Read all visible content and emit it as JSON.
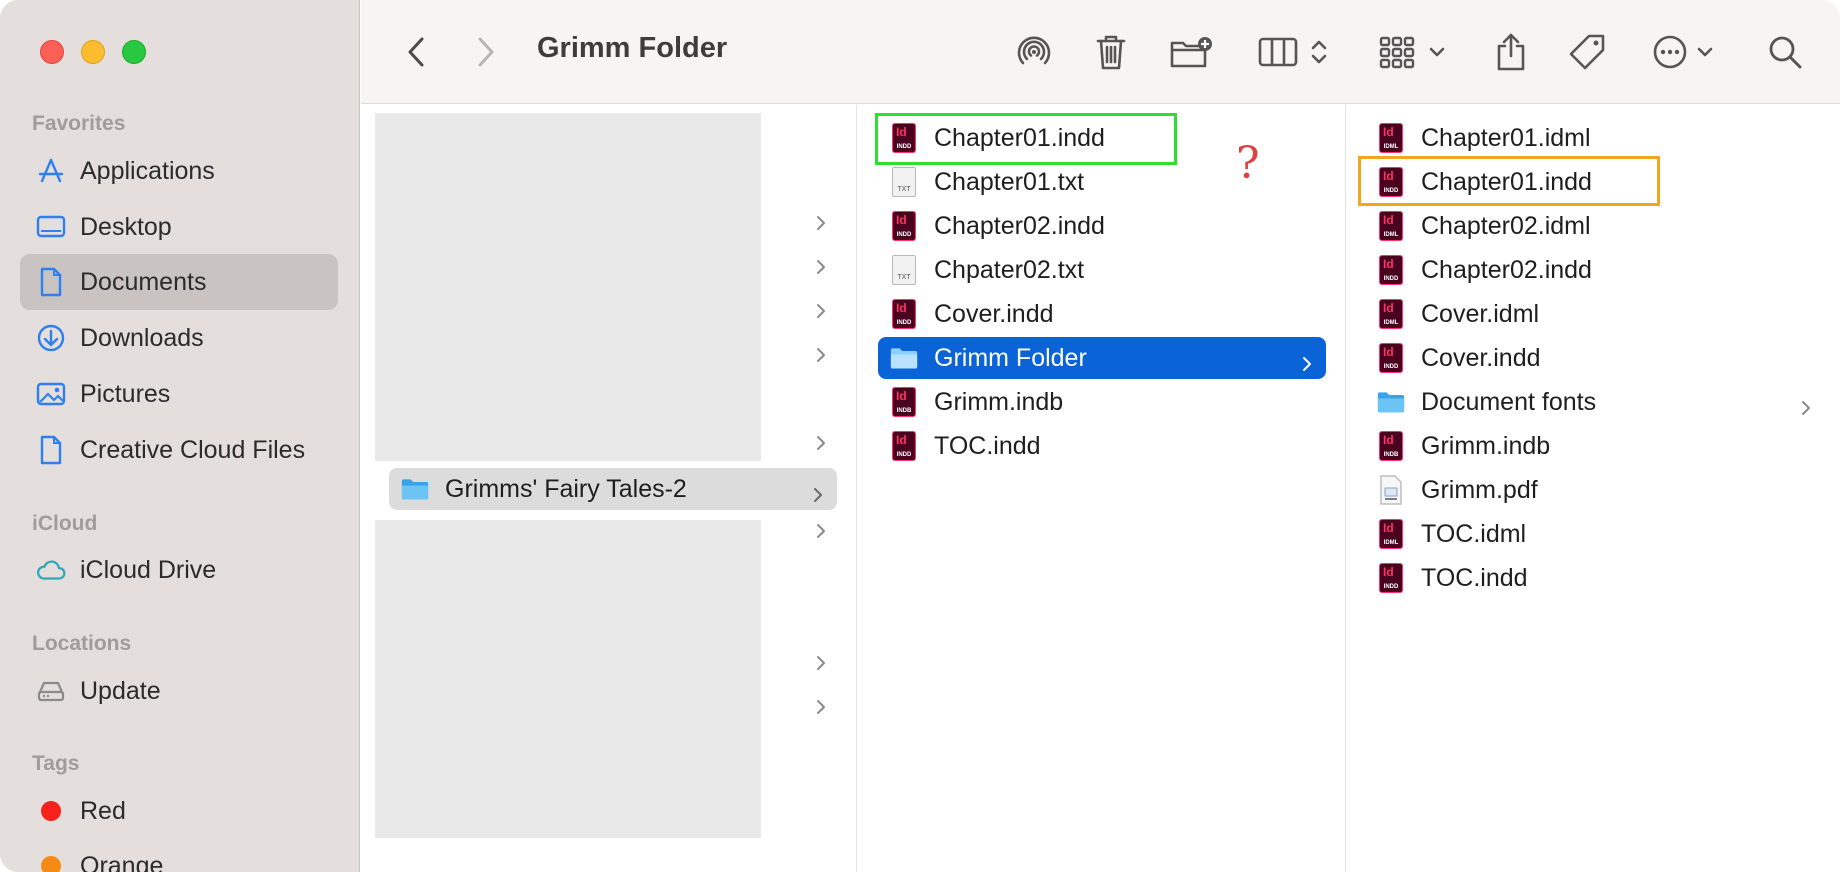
{
  "window": {
    "title": "Grimm Folder"
  },
  "sidebar": {
    "sections": {
      "favorites": "Favorites",
      "icloud": "iCloud",
      "locations": "Locations",
      "tags": "Tags"
    },
    "favorites": [
      "Applications",
      "Desktop",
      "Documents",
      "Downloads",
      "Pictures",
      "Creative Cloud Files"
    ],
    "icloud": [
      "iCloud Drive"
    ],
    "locations": [
      "Update"
    ],
    "tags": [
      {
        "label": "Red",
        "color": "#f5211a"
      },
      {
        "label": "Orange",
        "color": "#f58a14"
      }
    ],
    "active": "Documents"
  },
  "toolbar": {
    "icons": [
      "back-icon",
      "forward-icon",
      "airdrop-icon",
      "trash-icon",
      "new-folder-icon",
      "view-columns-icon",
      "group-icon",
      "share-icon",
      "tag-icon",
      "more-icon",
      "search-icon"
    ]
  },
  "columns": {
    "col1": {
      "selected_folder": "Grimms' Fairy Tales-2"
    },
    "col2": {
      "items": [
        {
          "name": "Chapter01.indd",
          "kind": "indd",
          "ext": "INDD"
        },
        {
          "name": "Chapter01.txt",
          "kind": "txt",
          "ext": "TXT"
        },
        {
          "name": "Chapter02.indd",
          "kind": "indd",
          "ext": "INDD"
        },
        {
          "name": "Chpater02.txt",
          "kind": "txt",
          "ext": "TXT"
        },
        {
          "name": "Cover.indd",
          "kind": "indd",
          "ext": "INDD"
        },
        {
          "name": "Grimm Folder",
          "kind": "folder"
        },
        {
          "name": "Grimm.indb",
          "kind": "indd",
          "ext": "INDB"
        },
        {
          "name": "TOC.indd",
          "kind": "indd",
          "ext": "INDD"
        }
      ],
      "selected": "Grimm Folder"
    },
    "col3": {
      "items": [
        {
          "name": "Chapter01.idml",
          "kind": "indd",
          "ext": "IDML"
        },
        {
          "name": "Chapter01.indd",
          "kind": "indd",
          "ext": "INDD"
        },
        {
          "name": "Chapter02.idml",
          "kind": "indd",
          "ext": "IDML"
        },
        {
          "name": "Chapter02.indd",
          "kind": "indd",
          "ext": "INDD"
        },
        {
          "name": "Cover.idml",
          "kind": "indd",
          "ext": "IDML"
        },
        {
          "name": "Cover.indd",
          "kind": "indd",
          "ext": "INDD"
        },
        {
          "name": "Document fonts",
          "kind": "folder"
        },
        {
          "name": "Grimm.indb",
          "kind": "indd",
          "ext": "INDB"
        },
        {
          "name": "Grimm.pdf",
          "kind": "pdf"
        },
        {
          "name": "TOC.idml",
          "kind": "indd",
          "ext": "IDML"
        },
        {
          "name": "TOC.indd",
          "kind": "indd",
          "ext": "INDD"
        }
      ]
    }
  },
  "annotations": {
    "question_mark": "?",
    "green_highlight_color": "#2ee02e",
    "orange_highlight_color": "#f2a620"
  }
}
